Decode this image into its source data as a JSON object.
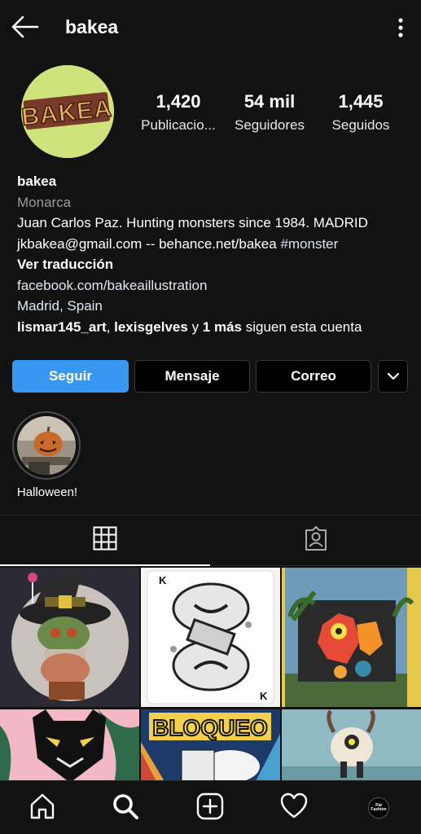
{
  "header": {
    "title": "bakea",
    "back_icon": "arrow-left-icon",
    "menu_icon": "more-vertical-icon"
  },
  "avatar": {
    "logo_text": "BAKEA",
    "background": "#cfe37d"
  },
  "stats": [
    {
      "value": "1,420",
      "label": "Publicacio..."
    },
    {
      "value": "54 mil",
      "label": "Seguidores"
    },
    {
      "value": "1,445",
      "label": "Seguidos"
    }
  ],
  "bio": {
    "name": "bakea",
    "category": "Monarca",
    "line1": "Juan Carlos Paz. Hunting monsters since 1984. MADRID",
    "line2_text": "jkbakea@gmail.com -- behance.net/bakea ",
    "line2_hashtag": "#monster",
    "translate": "Ver traducción",
    "link": "facebook.com/bakeaillustration",
    "location": "Madrid, Spain",
    "followed_by": {
      "user1": "lismar145_art",
      "sep": ", ",
      "user2": "lexisgelves",
      "and": " y ",
      "more": "1 más",
      "tail": " siguen esta cuenta"
    }
  },
  "buttons": {
    "follow": "Seguir",
    "message": "Mensaje",
    "email": "Correo",
    "more_icon": "chevron-down-icon"
  },
  "highlights": [
    {
      "label": "Halloween!"
    }
  ],
  "tabs": {
    "grid_icon": "grid-icon",
    "tagged_icon": "tagged-person-icon"
  },
  "posts": [
    {
      "description": "monster-witch-illustration"
    },
    {
      "description": "king-of-spades-card"
    },
    {
      "description": "monster-mural"
    },
    {
      "description": "black-cat-illustration"
    },
    {
      "description": "bloqueo-lettering",
      "text": "BLOQUEO"
    },
    {
      "description": "horned-creature"
    }
  ],
  "bottom_nav": {
    "home_icon": "home-icon",
    "search_icon": "search-icon",
    "add_icon": "add-post-icon",
    "activity_icon": "heart-icon",
    "profile_avatar_text": "Pat Fashion"
  },
  "colors": {
    "background": "#121212",
    "accent": "#3897f0",
    "secondary_text": "#9a9a9a"
  }
}
